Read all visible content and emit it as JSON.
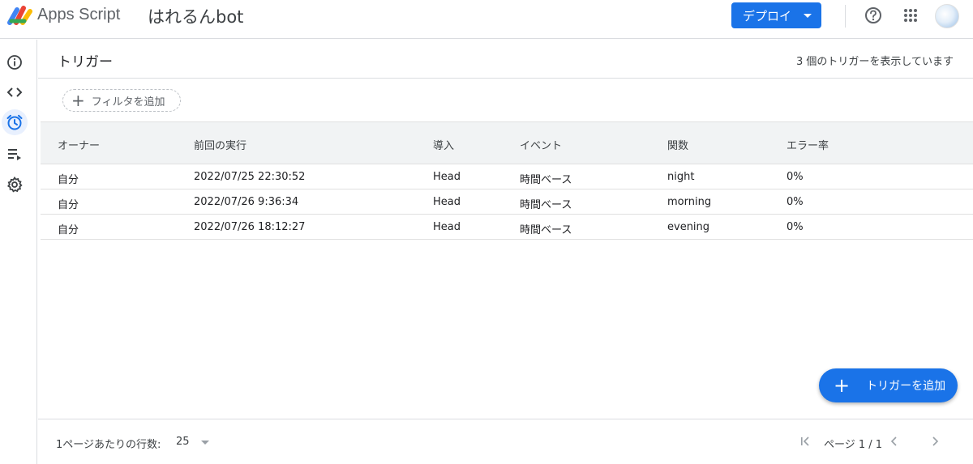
{
  "header": {
    "app_name": "Apps Script",
    "project_name": "はれるんbot",
    "deploy_label": "デプロイ",
    "help_icon": "help-circle-icon",
    "apps_icon": "apps-grid-icon",
    "accent_color": "#1a73e8"
  },
  "sidebar": {
    "items": [
      {
        "icon": "info-icon",
        "active": false
      },
      {
        "icon": "code-icon",
        "active": false
      },
      {
        "icon": "alarm-clock-icon",
        "active": true
      },
      {
        "icon": "executions-icon",
        "active": false
      },
      {
        "icon": "gear-icon",
        "active": false
      }
    ]
  },
  "page": {
    "title": "トリガー",
    "trigger_count": "3 個のトリガーを表示しています",
    "filter_label": "フィルタを追加"
  },
  "table": {
    "columns": [
      "オーナー",
      "前回の実行",
      "導入",
      "イベント",
      "関数",
      "エラー率"
    ],
    "rows": [
      {
        "owner": "自分",
        "last_run": "2022/07/25 22:30:52",
        "deployment": "Head",
        "event": "時間ベース",
        "function": "night",
        "error_rate": "0%"
      },
      {
        "owner": "自分",
        "last_run": "2022/07/26 9:36:34",
        "deployment": "Head",
        "event": "時間ベース",
        "function": "morning",
        "error_rate": "0%"
      },
      {
        "owner": "自分",
        "last_run": "2022/07/26 18:12:27",
        "deployment": "Head",
        "event": "時間ベース",
        "function": "evening",
        "error_rate": "0%"
      }
    ]
  },
  "fab": {
    "label": "トリガーを追加"
  },
  "footer": {
    "rows_per_page_label": "1ページあたりの行数:",
    "rows_per_page_value": "25",
    "page_indicator": "ページ 1 / 1"
  }
}
